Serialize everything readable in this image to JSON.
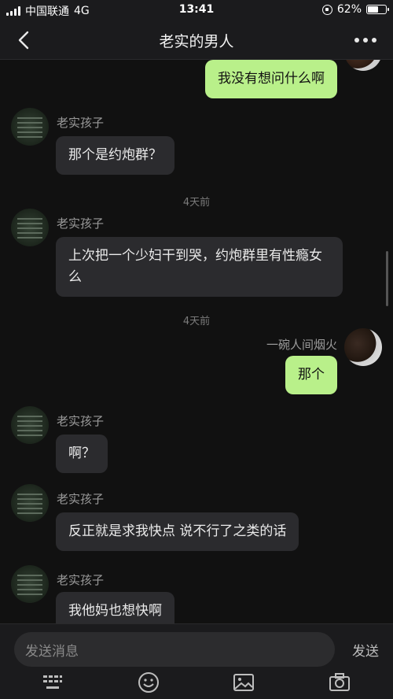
{
  "status": {
    "carrier": "中国联通",
    "network": "4G",
    "time": "13:41",
    "battery": "62%",
    "battery_level": 0.62
  },
  "header": {
    "title": "老实的男人",
    "back_icon": "chevron-left-icon",
    "more_icon": "more-dots-icon"
  },
  "messages": [
    {
      "dir": "out",
      "text": "我没有想问什么啊"
    },
    {
      "dir": "in",
      "sender": "老实孩子",
      "text": "那个是约炮群？"
    },
    {
      "time": "4天前"
    },
    {
      "dir": "in",
      "sender": "老实孩子",
      "text": "上次把一个少妇干到哭，约炮群里有性瘾女么"
    },
    {
      "time": "4天前"
    },
    {
      "dir": "out",
      "sender": "一碗人间烟火",
      "text": "那个"
    },
    {
      "dir": "in",
      "sender": "老实孩子",
      "text": "啊？"
    },
    {
      "dir": "in",
      "sender": "老实孩子",
      "text": "反正就是求我快点 说不行了之类的话"
    },
    {
      "dir": "in",
      "sender": "老实孩子",
      "text": "我他妈也想快啊"
    }
  ],
  "input": {
    "placeholder": "发送消息",
    "send_label": "发送",
    "tools": [
      "keyboard-icon",
      "emoji-icon",
      "image-icon",
      "camera-icon"
    ]
  },
  "colors": {
    "background": "#111111",
    "bubble_in": "#2b2b2e",
    "bubble_out": "#b9f08a"
  }
}
